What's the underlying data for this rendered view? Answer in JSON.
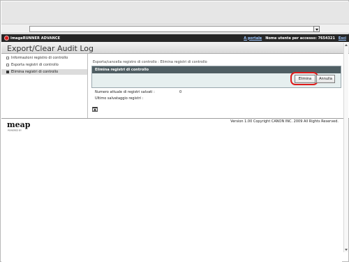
{
  "browser": {
    "address_value": ""
  },
  "header": {
    "brand": "imageRUNNER ADVANCE",
    "portal_link": "A portale",
    "user_label": "Nome utente per accesso: 7654321",
    "logout_link": "Esci"
  },
  "app": {
    "title": "Export/Clear Audit Log"
  },
  "sidebar": {
    "items": [
      {
        "label": "Informazioni registro di controllo"
      },
      {
        "label": "Esporta registri di controllo"
      },
      {
        "label": "Elimina registri di controllo"
      }
    ]
  },
  "main": {
    "breadcrumb": "Esporta/cancella registro di controllo : Elimina registri di controllo",
    "panel_title": "Elimina registri di controllo",
    "delete_label": "Elimina",
    "cancel_label": "Annulla",
    "saved_logs_label": "Numero attuale di registri salvati :",
    "saved_logs_value": "0",
    "last_saved_label": "Ultimo salvataggio registri :",
    "last_saved_value": ""
  },
  "footer": {
    "logo_text": "meap",
    "logo_sub": "POWERED BY",
    "copyright": "Version 1.00 Copyright CANON INC. 2009 All Rights Reserved."
  },
  "colors": {
    "header_bg": "#262626",
    "panel_head_bg": "#4f5e63",
    "panel_bg": "#e6efef",
    "highlight": "#dd1b1b",
    "link": "#9ec7ff",
    "logo_red": "#c41010"
  }
}
